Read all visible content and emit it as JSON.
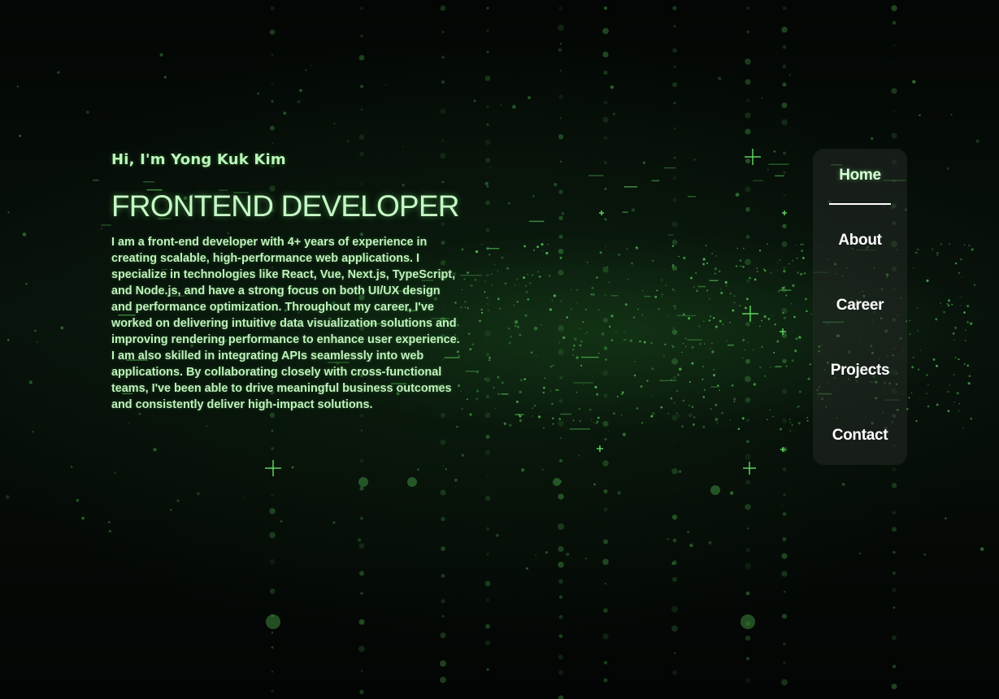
{
  "hero": {
    "greeting": "Hi, I'm Yong Kuk Kim",
    "title": "FRONTEND DEVELOPER",
    "description": "I am a front-end developer with 4+ years of experience in creating scalable, high-performance web applications. I specialize in technologies like React, Vue, Next.js, TypeScript, and Node.js, and have a strong focus on both UI/UX design and performance optimization. Throughout my career, I've worked on delivering intuitive data visualization solutions and improving rendering performance to enhance user experience. I am also skilled in integrating APIs seamlessly into web applications. By collaborating closely with cross-functional teams, I've been able to drive meaningful business outcomes and consistently deliver high-impact solutions."
  },
  "nav": {
    "items": [
      {
        "label": "Home",
        "active": true
      },
      {
        "label": "About",
        "active": false
      },
      {
        "label": "Career",
        "active": false
      },
      {
        "label": "Projects",
        "active": false
      },
      {
        "label": "Contact",
        "active": false
      }
    ]
  },
  "colors": {
    "accent": "#b9f5b9",
    "background": "#040806",
    "particle": "#5fd35f"
  }
}
